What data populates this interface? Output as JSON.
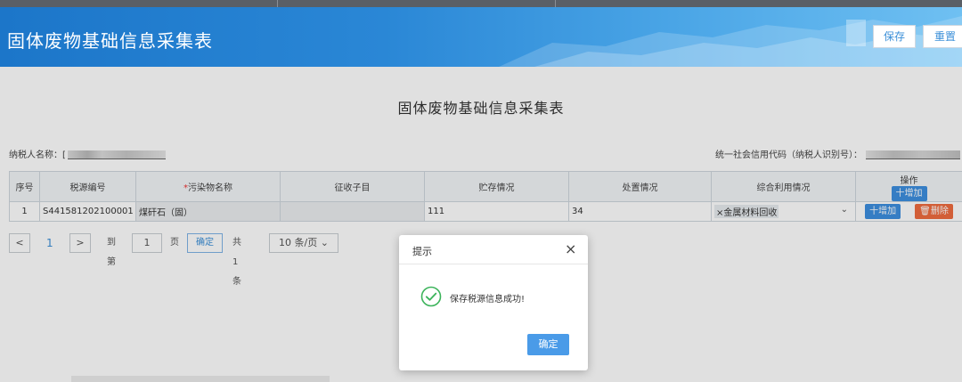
{
  "header": {
    "title": "固体废物基础信息采集表",
    "save_label": "保存",
    "reset_label": "重置"
  },
  "form": {
    "title": "固体废物基础信息采集表",
    "taxpayer_label": "纳税人名称：",
    "taxpayer_value_visible": "[",
    "credit_code_label": "统一社会信用代码（纳税人识别号）："
  },
  "table": {
    "columns": {
      "seq": "序号",
      "source_no": "税源编号",
      "pollutant_required": "*",
      "pollutant": "污染物名称",
      "subitem": "征收子目",
      "storage": "贮存情况",
      "disposal": "处置情况",
      "utilization": "综合利用情况",
      "ops": "操作",
      "add_header": "十增加"
    },
    "rows": [
      {
        "seq": "1",
        "source_no": "S441581202100001",
        "pollutant": "煤矸石（固）",
        "subitem": "",
        "storage": "111",
        "disposal": "34",
        "utilization": "×金属材料回收",
        "add_label": "十增加",
        "delete_label": "删除"
      }
    ]
  },
  "pager": {
    "prev": "<",
    "current_page": "1",
    "next": ">",
    "goto_label": "到第",
    "goto_value": "1",
    "page_unit": "页",
    "confirm_label": "确定",
    "total_label": "共 1 条",
    "page_size": "10 条/页"
  },
  "dialog": {
    "title": "提示",
    "close": "×",
    "message": "保存税源信息成功!",
    "ok_label": "确定"
  },
  "colors": {
    "banner": "#2a87d6",
    "primary_button": "#4a9be8",
    "delete_button": "#ef6b3f",
    "success_icon": "#3bb35a"
  }
}
